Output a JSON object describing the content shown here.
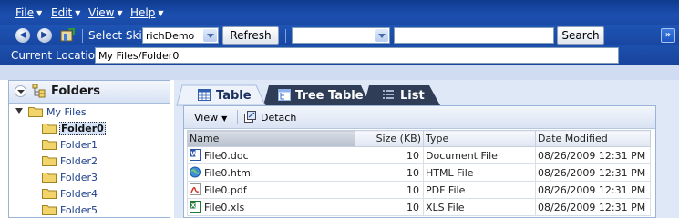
{
  "menubar": {
    "items": [
      {
        "label": "File"
      },
      {
        "label": "Edit"
      },
      {
        "label": "View"
      },
      {
        "label": "Help"
      }
    ]
  },
  "toolbar": {
    "back_icon": "back-icon",
    "forward_icon": "forward-icon",
    "home_icon": "home-icon",
    "skin_label": "Select Skin",
    "skin_value": "richDemo",
    "refresh_label": "Refresh",
    "search_type_value": "",
    "search_text_value": "",
    "search_label": "Search",
    "expand_icon": "double-chevron-right-icon"
  },
  "location": {
    "label": "Current Location:",
    "value": "My Files/Folder0"
  },
  "folders": {
    "title": "Folders",
    "root": "My Files",
    "items": [
      "Folder0",
      "Folder1",
      "Folder2",
      "Folder3",
      "Folder4",
      "Folder5"
    ],
    "selected": "Folder0"
  },
  "tabs": [
    {
      "label": "Table",
      "active": true
    },
    {
      "label": "Tree Table",
      "active": false
    },
    {
      "label": "List",
      "active": false
    }
  ],
  "subtoolbar": {
    "view_label": "View",
    "detach_label": "Detach"
  },
  "table": {
    "columns": [
      "Name",
      "Size (KB)",
      "Type",
      "Date Modified"
    ],
    "rows": [
      {
        "name": "File0.doc",
        "size": "10",
        "type": "Document File",
        "date": "08/26/2009 12:31 PM",
        "icon": "word-doc-icon"
      },
      {
        "name": "File0.html",
        "size": "10",
        "type": "HTML File",
        "date": "08/26/2009 12:31 PM",
        "icon": "html-globe-icon"
      },
      {
        "name": "File0.pdf",
        "size": "10",
        "type": "PDF File",
        "date": "08/26/2009 12:31 PM",
        "icon": "pdf-icon"
      },
      {
        "name": "File0.xls",
        "size": "10",
        "type": "XLS File",
        "date": "08/26/2009 12:31 PM",
        "icon": "excel-xls-icon"
      }
    ]
  },
  "colors": {
    "chrome_blue": "#1b4fb0",
    "panel_bg": "#dfe8f6",
    "folder_yellow": "#f1d46c"
  }
}
